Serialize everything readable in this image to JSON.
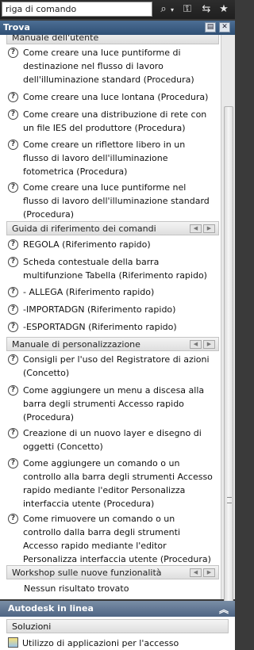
{
  "search": {
    "value": "riga di comando"
  },
  "toolbar": {
    "icons": [
      "binoculars-icon",
      "key-icon",
      "exchange-icon",
      "star-icon"
    ]
  },
  "panel": {
    "title": "Trova"
  },
  "sections": {
    "user_manual": {
      "title": "Manuale dell'utente"
    },
    "command_ref": {
      "title": "Guida di riferimento dei comandi"
    },
    "custom_manual": {
      "title": "Manuale di personalizzazione"
    },
    "workshop": {
      "title": "Workshop sulle nuove funzionalità"
    }
  },
  "user_manual_items": [
    "Come creare una luce puntiforme di destinazione nel flusso di lavoro dell'illuminazione standard (Procedura)",
    "Come creare una luce lontana (Procedura)",
    "Come creare una distribuzione di rete con un file IES del produttore (Procedura)",
    "Come creare un riflettore libero in un flusso di lavoro dell'illuminazione fotometrica (Procedura)",
    "Come creare una luce puntiforme nel flusso di lavoro dell'illuminazione standard (Procedura)"
  ],
  "command_ref_items": [
    "REGOLA (Riferimento rapido)",
    "Scheda contestuale della barra multifunzione Tabella (Riferimento rapido)",
    "- ALLEGA (Riferimento rapido)",
    "-IMPORTADGN (Riferimento rapido)",
    "-ESPORTADGN (Riferimento rapido)"
  ],
  "custom_manual_items": [
    "Consigli per l'uso del Registratore di azioni (Concetto)",
    "Come aggiungere un menu a discesa alla barra degli strumenti Accesso rapido (Procedura)",
    "Creazione di un nuovo layer e disegno di oggetti (Concetto)",
    "Come aggiungere un comando o un controllo alla barra degli strumenti Accesso rapido mediante l'editor Personalizza interfaccia utente (Procedura)",
    "Come rimuovere un comando o un controllo dalla barra degli strumenti Accesso rapido mediante l'editor Personalizza interfaccia utente (Procedura)"
  ],
  "workshop_empty": "Nessun risultato trovato",
  "online": {
    "title": "Autodesk in linea",
    "solutions_title": "Soluzioni",
    "first_item": "Utilizzo di applicazioni per l'accesso"
  }
}
